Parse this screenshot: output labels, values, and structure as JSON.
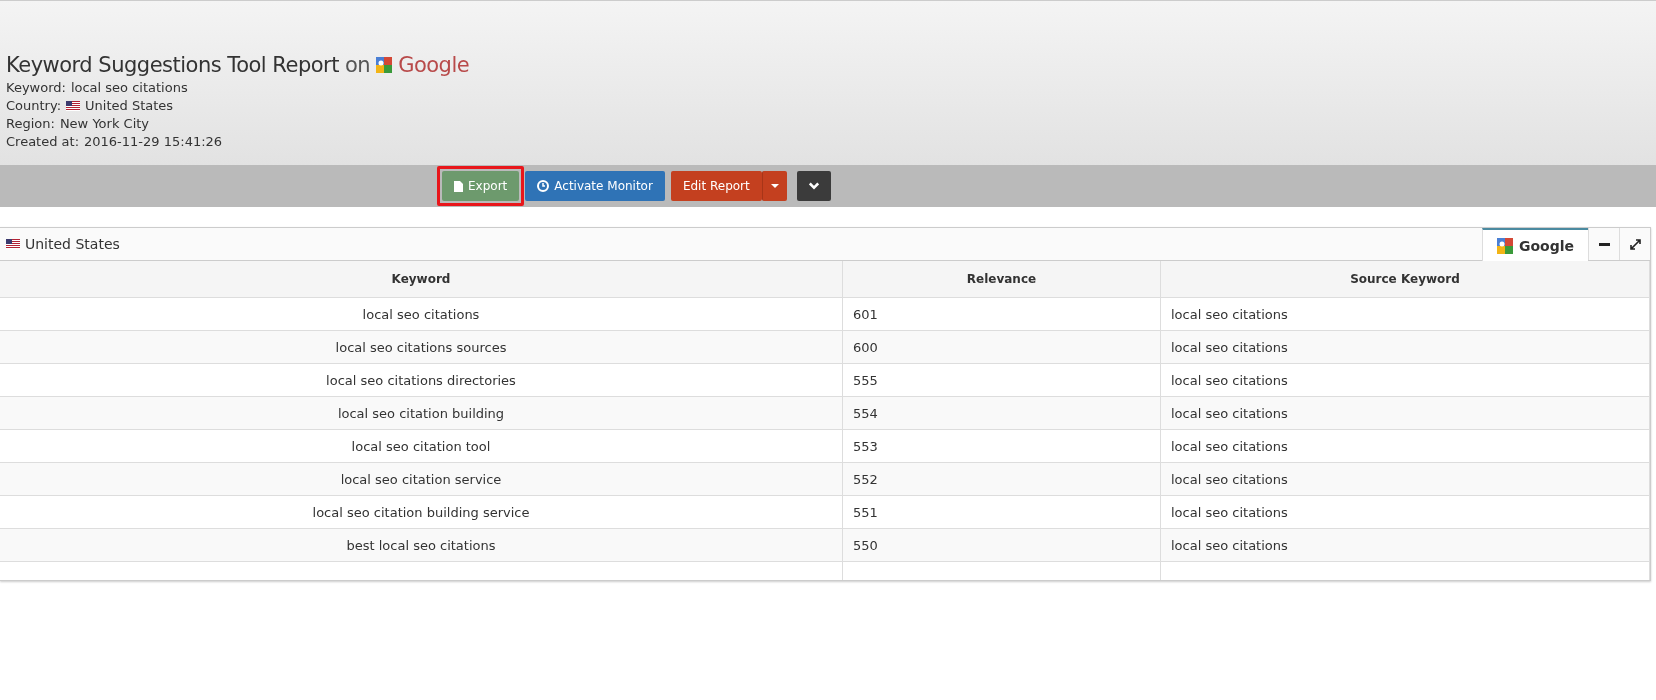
{
  "header": {
    "title": "Keyword Suggestions Tool Report",
    "title_connector": "on",
    "engine": "Google",
    "details": [
      {
        "kind": "text",
        "label": "Keyword:",
        "value": "local seo citations"
      },
      {
        "kind": "flag",
        "label": "Country:",
        "value": "United States"
      },
      {
        "kind": "text",
        "label": "Region:",
        "value": "New York City"
      },
      {
        "kind": "text",
        "label": "Created at:",
        "value": "2016-11-29 15:41:26"
      }
    ]
  },
  "toolbar": [
    {
      "kind": "export",
      "label": "Export",
      "highlighted": true
    },
    {
      "kind": "monitor",
      "label": "Activate Monitor",
      "highlighted": false
    },
    {
      "kind": "split",
      "label": "Edit Report",
      "highlighted": false
    },
    {
      "kind": "more",
      "highlighted": false
    }
  ],
  "panel": {
    "country": "United States",
    "tabs": [
      {
        "label": "Google",
        "selected": true
      }
    ],
    "table": {
      "columns": [
        "Keyword",
        "Relevance",
        "Source Keyword"
      ],
      "rows": [
        [
          "local seo citations",
          "601",
          "local seo citations"
        ],
        [
          "local seo citations sources",
          "600",
          "local seo citations"
        ],
        [
          "local seo citations directories",
          "555",
          "local seo citations"
        ],
        [
          "local seo citation building",
          "554",
          "local seo citations"
        ],
        [
          "local seo citation tool",
          "553",
          "local seo citations"
        ],
        [
          "local seo citation service",
          "552",
          "local seo citations"
        ],
        [
          "local seo citation building service",
          "551",
          "local seo citations"
        ],
        [
          "best local seo citations",
          "550",
          "local seo citations"
        ]
      ]
    }
  }
}
